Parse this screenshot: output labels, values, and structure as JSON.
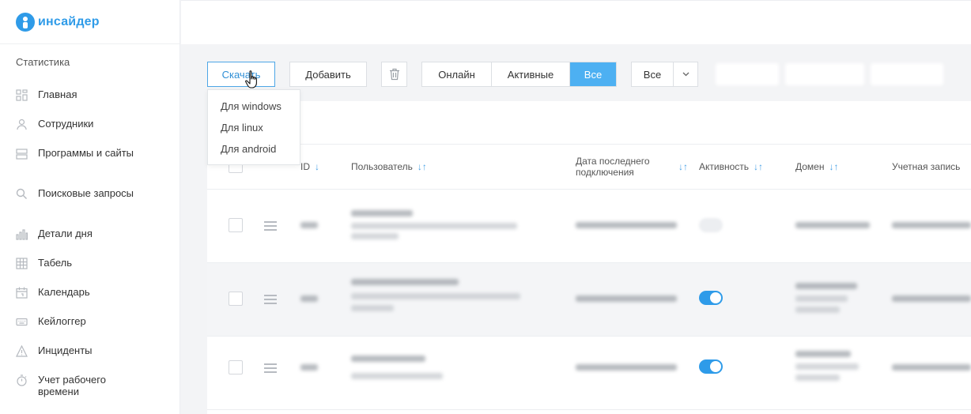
{
  "app": {
    "logo_text": "инсайдер"
  },
  "sidebar": {
    "section_title": "Статистика",
    "items": [
      {
        "label": "Главная",
        "icon": "dashboard-icon"
      },
      {
        "label": "Сотрудники",
        "icon": "user-icon"
      },
      {
        "label": "Программы и сайты",
        "icon": "apps-icon"
      },
      {
        "label": "Поисковые запросы",
        "icon": "search-icon"
      },
      {
        "label": "Детали дня",
        "icon": "bar-chart-icon"
      },
      {
        "label": "Табель",
        "icon": "table-icon"
      },
      {
        "label": "Календарь",
        "icon": "calendar-icon"
      },
      {
        "label": "Кейлоггер",
        "icon": "keyboard-icon"
      },
      {
        "label": "Инциденты",
        "icon": "warning-icon"
      },
      {
        "label": "Учет рабочего времени",
        "icon": "stopwatch-icon"
      }
    ]
  },
  "toolbar": {
    "download_label": "Скачать",
    "add_label": "Добавить",
    "filter_tabs": [
      "Онлайн",
      "Активные",
      "Все"
    ],
    "filter_active": "Все",
    "select_value": "Все",
    "colors": {
      "accent": "#4db0f2",
      "toggle_on": "#2e9be9"
    }
  },
  "download_menu": {
    "options": [
      "Для windows",
      "Для linux",
      "Для android"
    ]
  },
  "table": {
    "columns": {
      "id": "ID",
      "user": "Пользователь",
      "last_connection": "Дата последнего подключения",
      "activity": "Активность",
      "domain": "Домен",
      "account": "Учетная запись"
    },
    "rows": [
      {
        "active": false
      },
      {
        "active": true
      },
      {
        "active": true
      }
    ]
  }
}
